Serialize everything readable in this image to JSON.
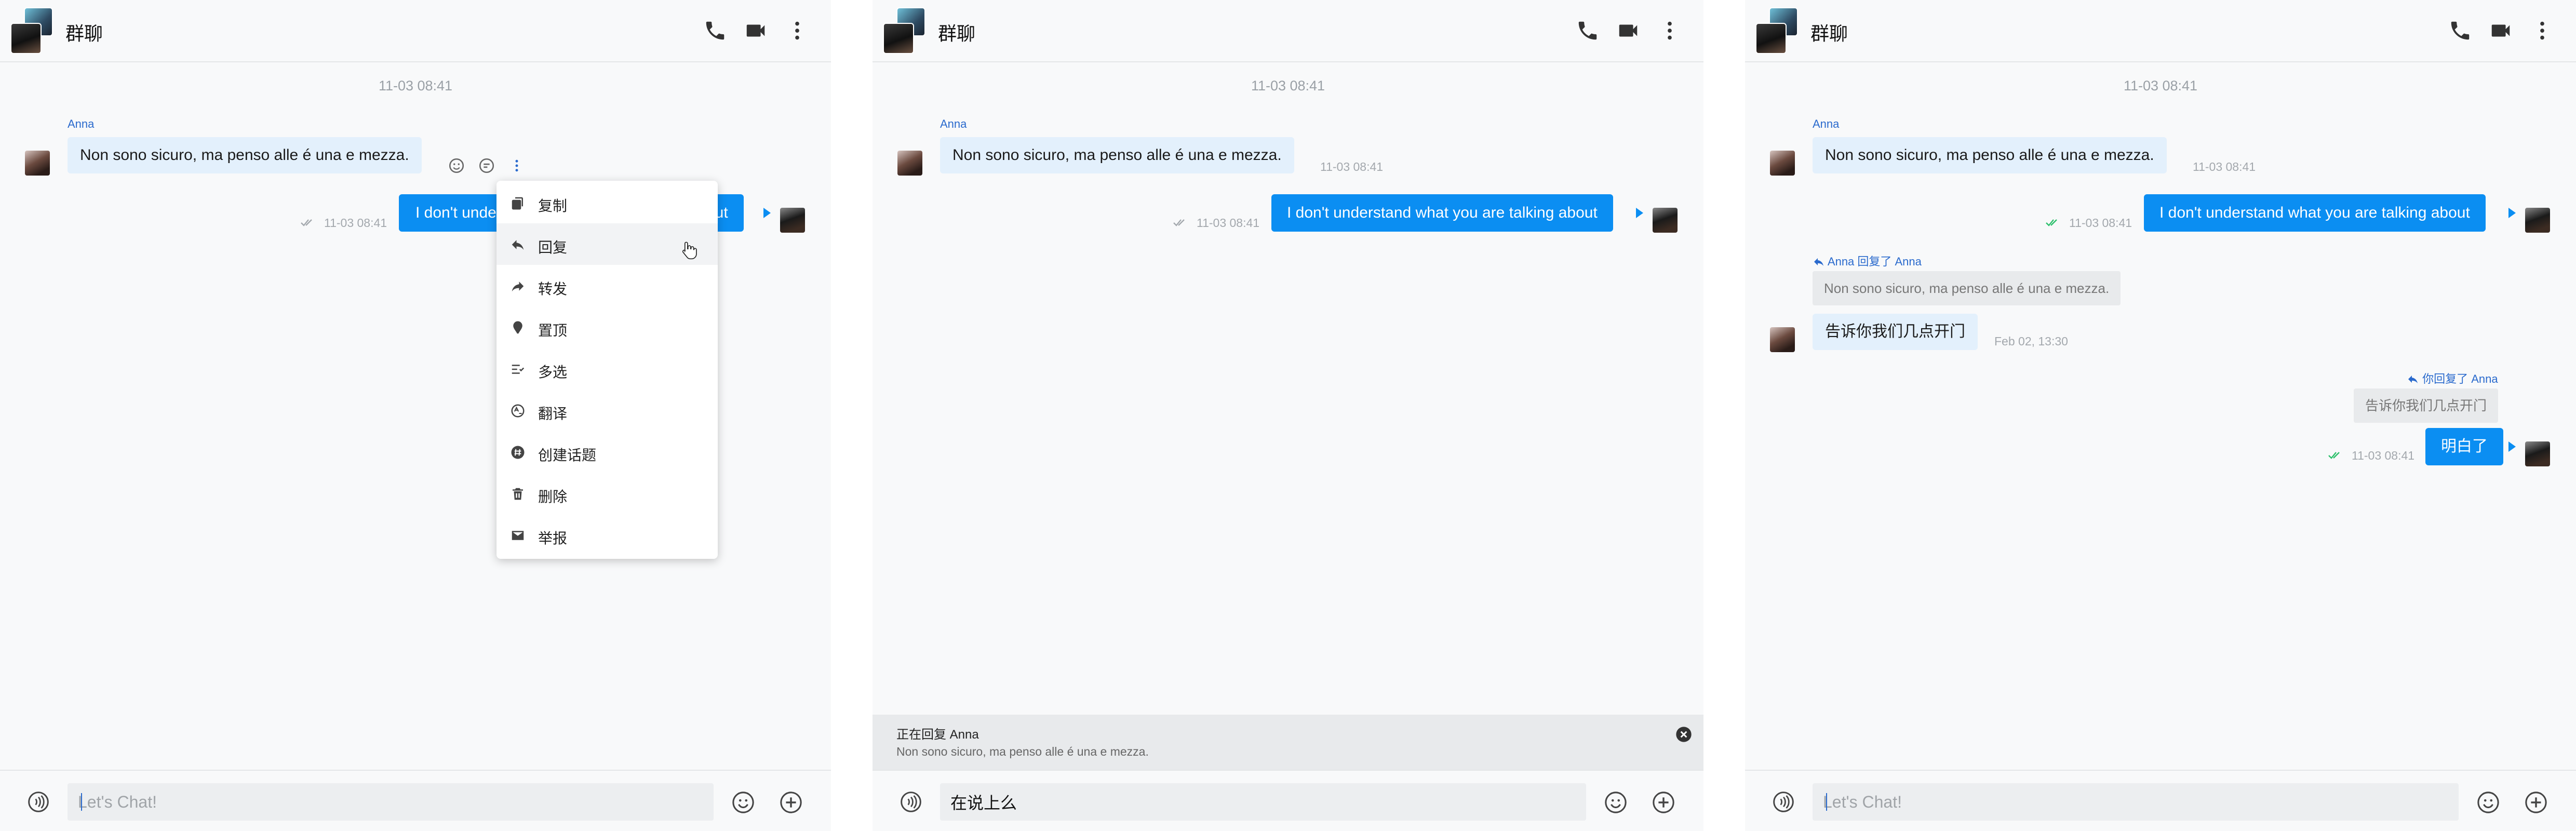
{
  "panels": [
    {
      "header": {
        "title": "群聊"
      },
      "date_divider": "11-03 08:41",
      "messages": {
        "anna_msg": {
          "sender": "Anna",
          "text": "Non sono sicuro, ma penso alle é una e mezza."
        },
        "my_msg": {
          "text_left": "I don't unde",
          "text_right": "out",
          "time": "11-03 08:41"
        }
      },
      "context_menu": {
        "items": [
          {
            "label": "复制",
            "icon": "copy-icon"
          },
          {
            "label": "回复",
            "icon": "reply-icon"
          },
          {
            "label": "转发",
            "icon": "forward-icon"
          },
          {
            "label": "置顶",
            "icon": "pin-icon"
          },
          {
            "label": "多选",
            "icon": "multiselect-icon"
          },
          {
            "label": "翻译",
            "icon": "translate-icon"
          },
          {
            "label": "创建话题",
            "icon": "topic-icon"
          },
          {
            "label": "删除",
            "icon": "trash-icon"
          },
          {
            "label": "举报",
            "icon": "mail-icon"
          }
        ],
        "hovered_item": "回复"
      },
      "composer": {
        "placeholder": "Let's Chat!",
        "value": ""
      }
    },
    {
      "header": {
        "title": "群聊"
      },
      "date_divider": "11-03 08:41",
      "messages": {
        "anna_msg": {
          "sender": "Anna",
          "text": "Non sono sicuro, ma penso alle é una e mezza.",
          "time": "11-03 08:41"
        },
        "my_msg": {
          "text": "I don't understand what you are talking about",
          "time": "11-03 08:41"
        }
      },
      "reply_bar": {
        "title_prefix": "正在回复",
        "title_name": "Anna",
        "quoted_text": "Non sono sicuro, ma penso alle é una e mezza."
      },
      "composer": {
        "placeholder": "Let's Chat!",
        "value": "在说上么"
      }
    },
    {
      "header": {
        "title": "群聊"
      },
      "date_divider": "11-03 08:41",
      "messages": {
        "anna_msg": {
          "sender": "Anna",
          "text": "Non sono sicuro, ma penso alle é una e mezza.",
          "time": "11-03 08:41"
        },
        "my_msg": {
          "text": "I don't understand what you are talking about",
          "time": "11-03 08:41"
        },
        "anna_reply": {
          "quote_label": "Anna 回复了 Anna",
          "quoted_text": "Non sono sicuro, ma penso alle é una e mezza.",
          "text": "告诉你我们几点开门",
          "time": "Feb 02, 13:30"
        },
        "my_reply": {
          "quote_label": "你回复了 Anna",
          "quoted_text": "告诉你我们几点开门",
          "text": "明白了",
          "time": "11-03 08:41"
        }
      },
      "composer": {
        "placeholder": "Let's Chat!",
        "value": ""
      }
    }
  ],
  "colors": {
    "accent": "#0b8ef2",
    "incoming_bubble": "#e3f0fc",
    "read_check_green": "#2bbf6a",
    "unread_check_gray": "#a3a8ad",
    "link_blue": "#2a6acd"
  }
}
